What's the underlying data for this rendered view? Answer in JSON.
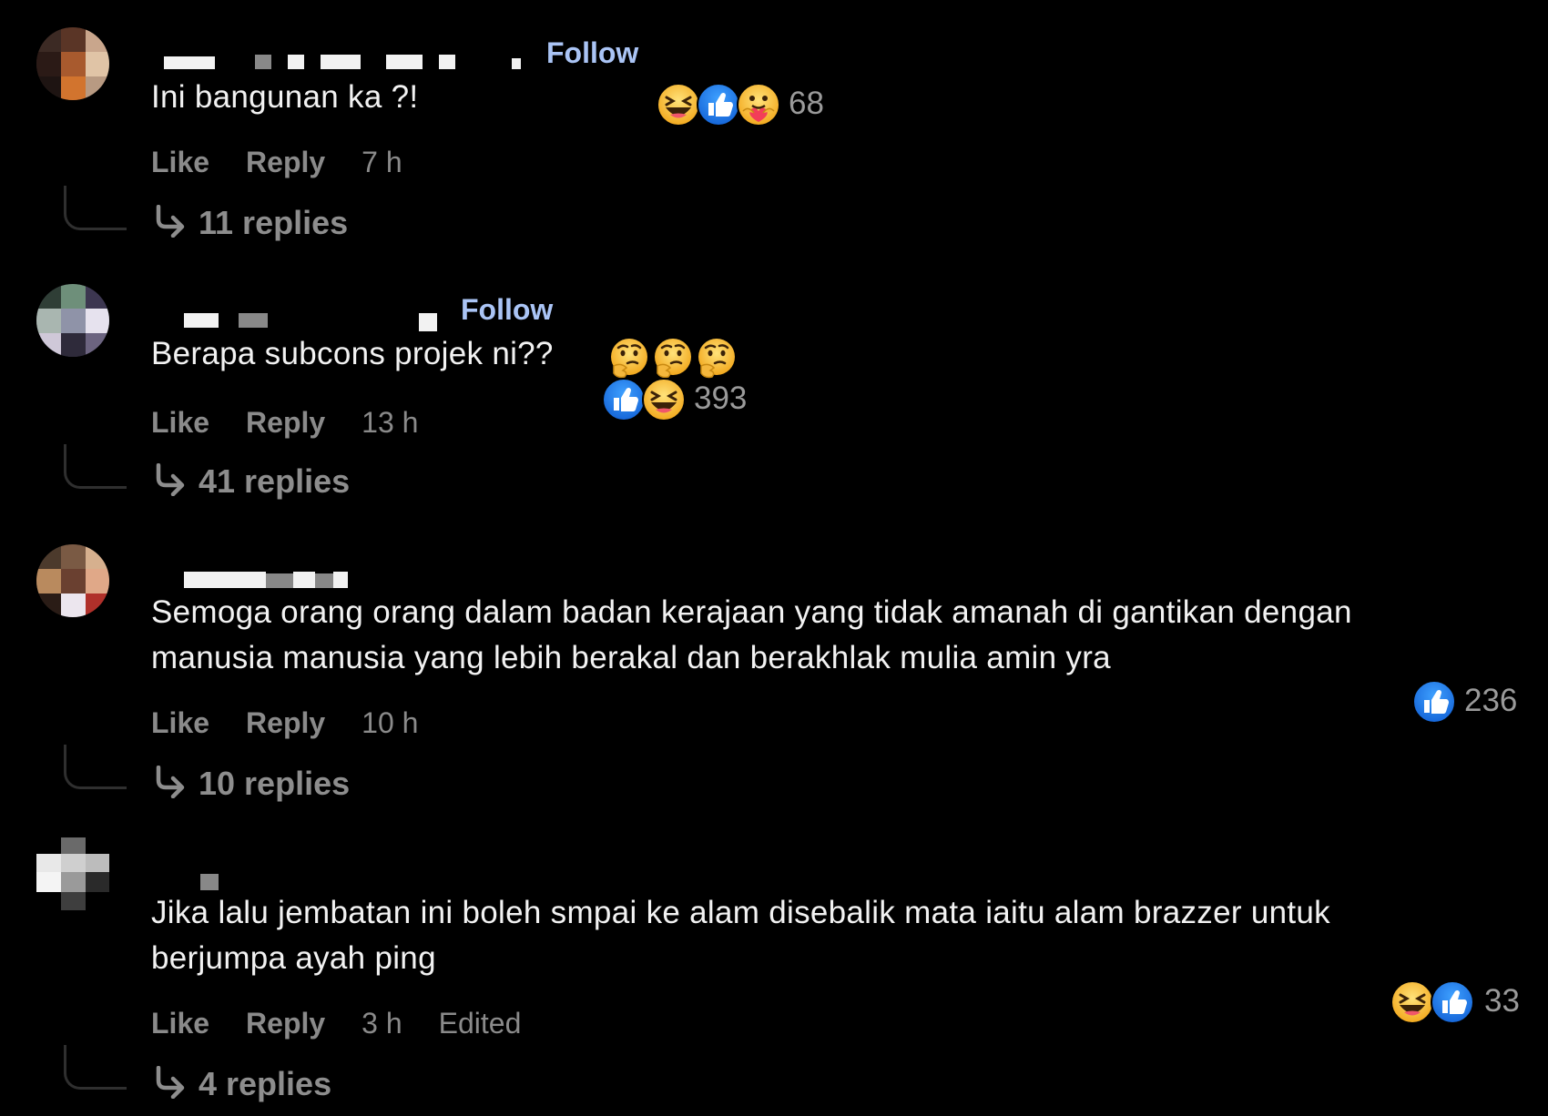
{
  "comments": [
    {
      "text": "Ini bangunan ka ?!",
      "follow_label": "Follow",
      "like_label": "Like",
      "reply_label": "Reply",
      "time": "7 h",
      "replies_label": "11 replies",
      "reaction_count": "68",
      "reactions": [
        "haha",
        "like",
        "care"
      ]
    },
    {
      "text": "Berapa subcons projek ni??",
      "inline_emojis": [
        "thinking-face",
        "thinking-face",
        "thinking-face"
      ],
      "follow_label": "Follow",
      "like_label": "Like",
      "reply_label": "Reply",
      "time": "13 h",
      "replies_label": "41 replies",
      "reaction_count": "393",
      "reactions": [
        "like",
        "haha"
      ]
    },
    {
      "text_lines": [
        "Semoga orang orang dalam badan kerajaan yang tidak amanah di gantikan dengan",
        "manusia manusia yang lebih berakal dan berakhlak mulia amin yra"
      ],
      "like_label": "Like",
      "reply_label": "Reply",
      "time": "10 h",
      "replies_label": "10 replies",
      "reaction_count": "236",
      "reactions": [
        "like"
      ]
    },
    {
      "text_lines": [
        "Jika lalu jembatan ini boleh smpai ke alam disebalik mata iaitu alam brazzer untuk",
        "berjumpa ayah ping"
      ],
      "like_label": "Like",
      "reply_label": "Reply",
      "time": "3 h",
      "edited_label": "Edited",
      "replies_label": "4 replies",
      "reaction_count": "33",
      "reactions": [
        "haha",
        "like"
      ]
    }
  ],
  "colors": {
    "background": "#000000",
    "follow": "#aac4f5",
    "text": "#f2f2f2",
    "muted": "#8a8a8a",
    "like_blue": "#1877f2",
    "haha_yellow": "#f7b928"
  }
}
